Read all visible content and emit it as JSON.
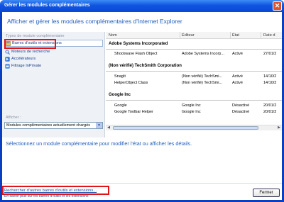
{
  "window": {
    "title": "Gérer les modules complémentaires",
    "close_glyph": "✕"
  },
  "header": {
    "title": "Afficher et gérer les modules complémentaires d'Internet Explorer"
  },
  "left": {
    "types_label": "Types de module complémentaire",
    "items": [
      {
        "label": "Barres d'outils et extensions",
        "icon": "toolbar-icon"
      },
      {
        "label": "Moteurs de recherche",
        "icon": "search-icon"
      },
      {
        "label": "Accélérateurs",
        "icon": "accelerator-icon"
      },
      {
        "label": "Filtrage InPrivate",
        "icon": "inprivate-icon"
      }
    ],
    "show_label": "Afficher :",
    "show_value": "Modules complémentaires actuellement chargés"
  },
  "table": {
    "columns": [
      "Nom",
      "Éditeur",
      "État",
      "Date d"
    ],
    "groups": [
      {
        "name": "Adobe Systems Incorporated",
        "rows": [
          {
            "name": "Shockwave Flash Object",
            "publisher": "Adobe Systems Incorp...",
            "status": "Activé",
            "date": "27/01/2"
          }
        ]
      },
      {
        "name": "(Non vérifié) TechSmith Corporation",
        "rows": [
          {
            "name": "SnagIt",
            "publisher": "(Non vérifié) TechSmi...",
            "status": "Activé",
            "date": "14/10/2"
          },
          {
            "name": "HelperObject Class",
            "publisher": "(Non vérifié) TechSmi...",
            "status": "Activé",
            "date": "14/10/2"
          }
        ]
      },
      {
        "name": "Google Inc",
        "rows": [
          {
            "name": "Google",
            "publisher": "Google Inc",
            "status": "Désactivé",
            "date": "20/01/2"
          },
          {
            "name": "Google Toolbar Helper",
            "publisher": "Google Inc",
            "status": "Désactivé",
            "date": "20/01/2"
          }
        ]
      }
    ]
  },
  "hint": "Sélectionnez un module complémentaire pour modifier l'état ou afficher les détails.",
  "footer": {
    "link": "Rechercher d'autres barres d'outils et extensions...",
    "sublink": "En savoir plus sur les barres d'outils et les extensions",
    "close_label": "Fermer"
  },
  "colors": {
    "accent": "#1f5fbf",
    "highlight": "#e0151a",
    "titlebar": "#0a47d4"
  }
}
